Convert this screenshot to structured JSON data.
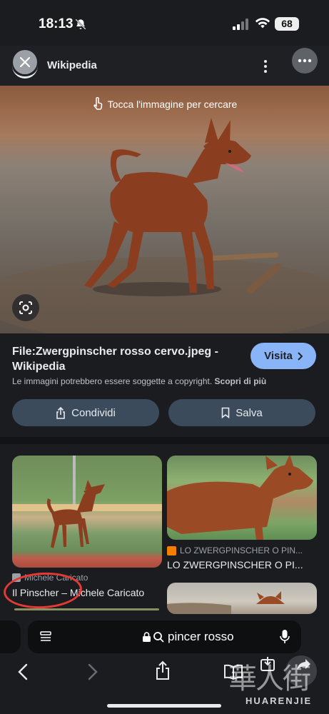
{
  "status_bar": {
    "time": "18:13",
    "battery": "68",
    "icons": [
      "bell-slash-icon",
      "cellular-signal-icon",
      "wifi-icon",
      "battery-icon"
    ]
  },
  "header": {
    "site_name": "Wikipedia",
    "icons": [
      "close-icon",
      "wikipedia-logo-icon",
      "more-vertical-icon",
      "more-horizontal-icon"
    ]
  },
  "hero": {
    "hint": "Tocca l'immagine per cercare",
    "icons": [
      "tap-hand-icon",
      "lens-search-icon"
    ]
  },
  "result_detail": {
    "file_title": "File:Zwergpinscher rosso cervo.jpeg - Wikipedia",
    "visit_label": "Visita",
    "copyright_text": "Le immagini potrebbero essere soggette a copyright.",
    "learn_more": "Scopri di più",
    "share_label": "Condividi",
    "save_label": "Salva",
    "accent_color": "#8ab4f8",
    "button_color": "#3c4b5c"
  },
  "related": [
    {
      "source": "Michele Caricato",
      "title": "Il Pinscher – Michele Caricato",
      "annotated": true,
      "annotation_color": "#e53935"
    },
    {
      "source": "LO ZWERGPINSCHER O PIN...",
      "title": "LO ZWERGPINSCHER O PI..."
    }
  ],
  "url_bar": {
    "query": "pincer rosso",
    "icons": [
      "tabs-menu-icon",
      "lock-icon",
      "search-icon",
      "microphone-icon"
    ]
  },
  "toolbar": {
    "icons": [
      "back-icon",
      "forward-icon",
      "share-icon",
      "bookmarks-icon",
      "download-icon",
      "tabs-icon"
    ]
  },
  "watermark": {
    "cjk": "華人街",
    "latin": "HUARENJIE"
  }
}
